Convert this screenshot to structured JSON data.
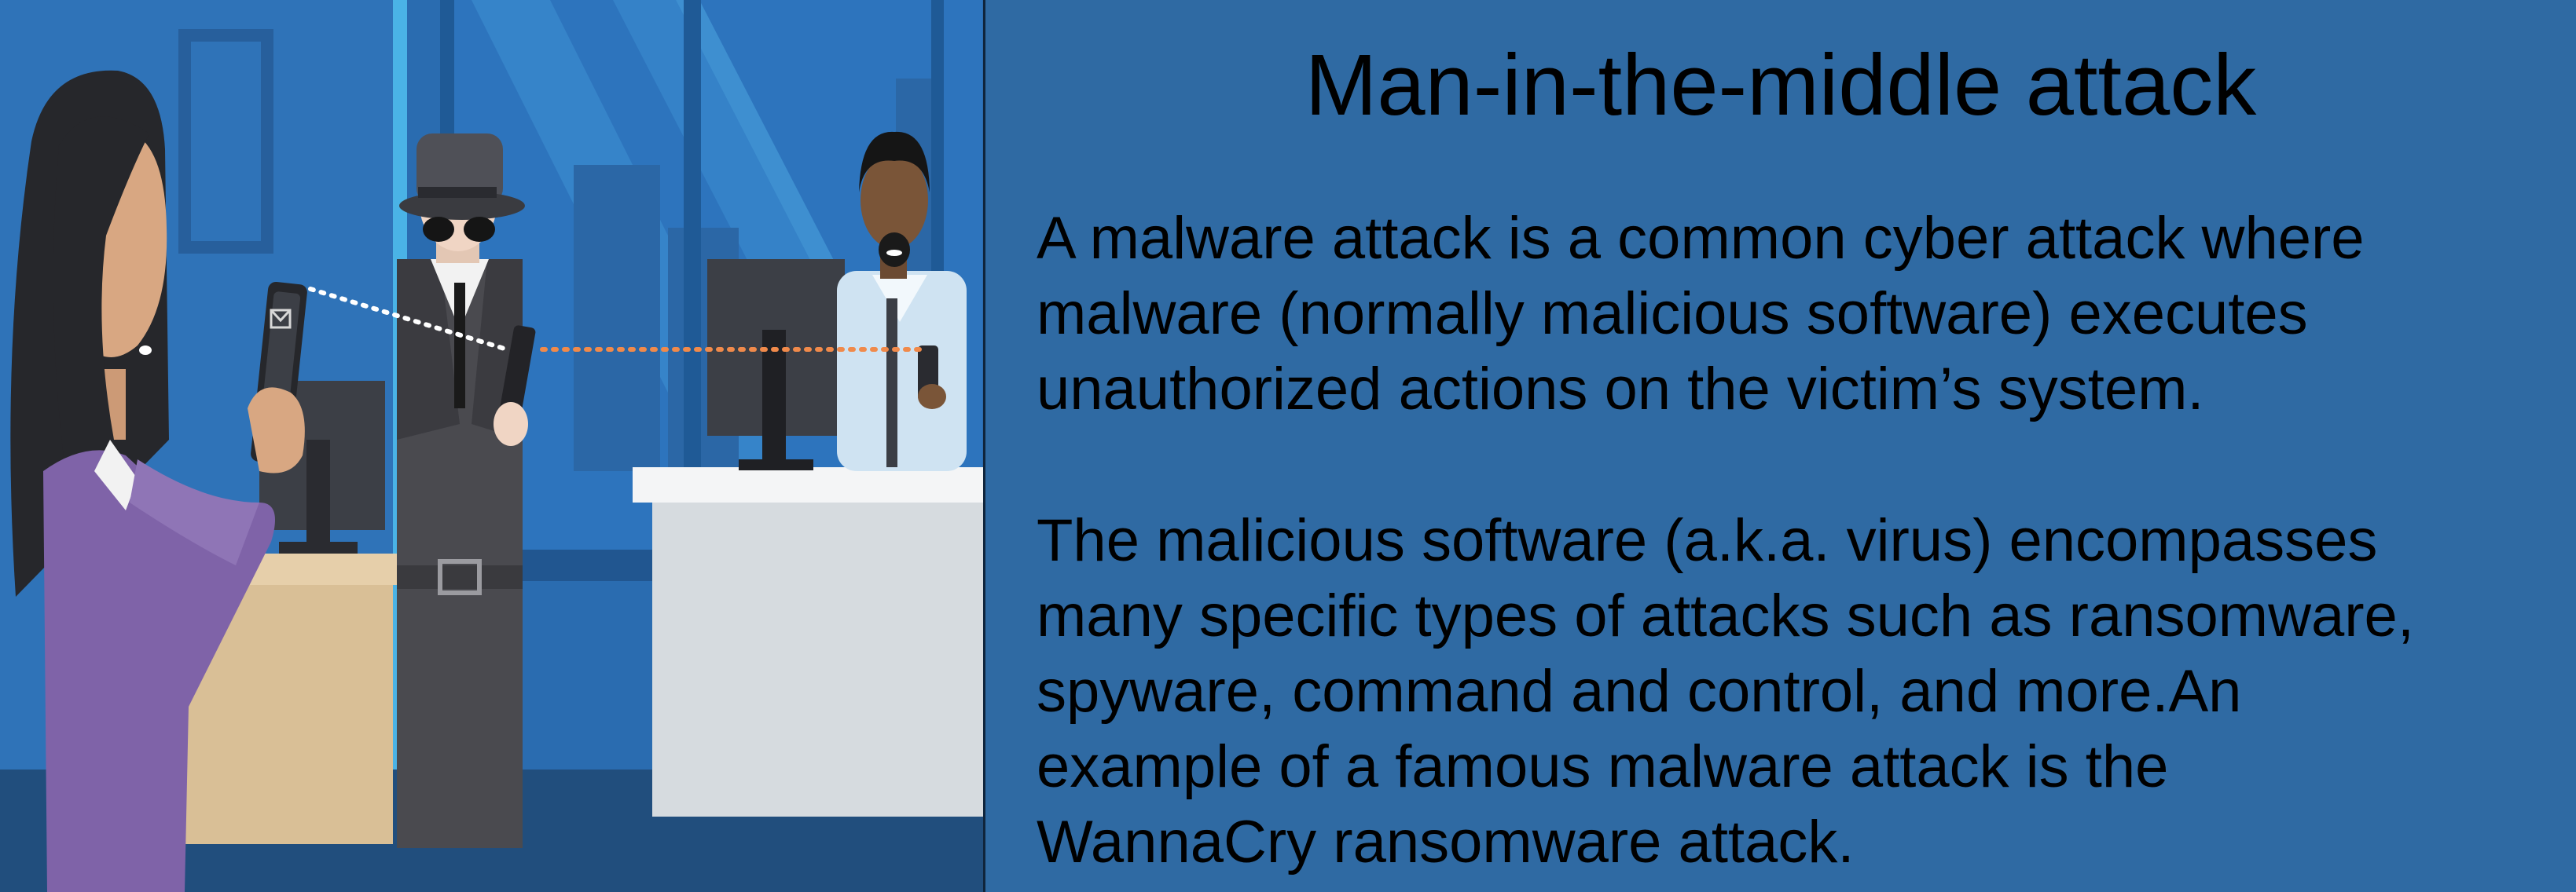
{
  "slide": {
    "title": "Man-in-the-middle attack",
    "paragraphs": [
      "A malware attack is a common cyber attack where\nmalware (normally malicious software) executes\nunauthorized actions on the victim’s system.",
      "The malicious software (a.k.a. virus) encompasses\nmany specific types of attacks such as ransomware,\nspyware, command and control, and more.An\nexample of a famous malware attack is the\nWannaCry ransomware attack."
    ]
  },
  "illustration": {
    "figures": [
      "woman-with-phone",
      "eavesdropper-in-hat",
      "man-with-phone"
    ],
    "colors": {
      "background": "#2a6cb0",
      "woman_jacket": "#7f63a8",
      "desk_left": "#d9bf96",
      "desk_right": "#dfe3e6",
      "spy_coat": "#4a4a4f",
      "shirt_right": "#cfe3f2",
      "dotted_white": "#ffffff",
      "dotted_orange": "#f08a4b"
    }
  }
}
